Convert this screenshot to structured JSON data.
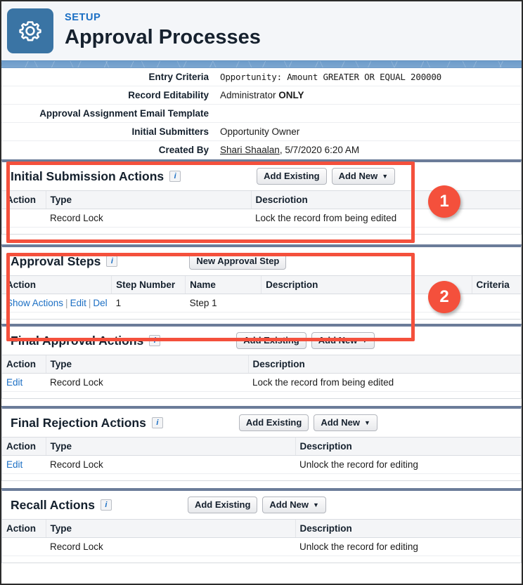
{
  "header": {
    "eyebrow": "SETUP",
    "title": "Approval Processes",
    "gear_icon": "gear-icon"
  },
  "detail_rows": [
    {
      "label": "Entry Criteria",
      "value": "Opportunity:  Amount  GREATER OR EQUAL 200000",
      "style": "mono"
    },
    {
      "label": "Record Editability",
      "value_prefix": "Administrator ",
      "value_bold": "ONLY"
    },
    {
      "label": "Approval Assignment Email Template",
      "value": ""
    },
    {
      "label": "Initial Submitters",
      "value": "Opportunity Owner"
    },
    {
      "label": "Created By",
      "link_text": "Shari Shaalan",
      "value_suffix": ", 5/7/2020 6:20 AM"
    }
  ],
  "panels": [
    {
      "title": "Initial Submission Actions",
      "info_icon": "info-icon",
      "buttons": [
        {
          "label": "Add Existing",
          "has_caret": false
        },
        {
          "label": "Add New",
          "has_caret": true
        }
      ],
      "columns": [
        "Action",
        "Type",
        "Descriotion"
      ],
      "rows": [
        {
          "action": "",
          "type": "Record Lock",
          "description": "Lock the record from being edited"
        }
      ]
    },
    {
      "title": "Approval Steps",
      "info_icon": "info-icon",
      "buttons": [
        {
          "label": "New Approval Step",
          "has_caret": false
        }
      ],
      "columns": [
        "Action",
        "Step Number",
        "Name",
        "Description",
        "Criteria"
      ],
      "rows": [
        {
          "links": [
            "Show Actions",
            "Edit",
            "Del"
          ],
          "step_number": "1",
          "name": "Step 1",
          "description": "",
          "criteria": ""
        }
      ]
    },
    {
      "title": "Final Approval Actions",
      "info_icon": "info-icon",
      "buttons": [
        {
          "label": "Add Existing",
          "has_caret": false
        },
        {
          "label": "Add New",
          "has_caret": true
        }
      ],
      "columns": [
        "Action",
        "Type",
        "Description"
      ],
      "rows": [
        {
          "action": "Edit",
          "type": "Record Lock",
          "description": "Lock the record from being edited"
        }
      ]
    },
    {
      "title": "Final Rejection Actions",
      "info_icon": "info-icon",
      "buttons": [
        {
          "label": "Add Existing",
          "has_caret": false
        },
        {
          "label": "Add New",
          "has_caret": true
        }
      ],
      "columns": [
        "Action",
        "Type",
        "Description"
      ],
      "rows": [
        {
          "action": "Edit",
          "type": "Record Lock",
          "description": "Unlock the record for editing"
        }
      ]
    },
    {
      "title": "Recall Actions",
      "info_icon": "info-icon",
      "buttons": [
        {
          "label": "Add Existing",
          "has_caret": false
        },
        {
          "label": "Add New",
          "has_caret": true
        }
      ],
      "columns": [
        "Action",
        "Type",
        "Description"
      ],
      "rows": [
        {
          "action": "",
          "type": "Record Lock",
          "description": "Unlock the record for editing"
        }
      ]
    }
  ],
  "annotations": [
    {
      "number": "1",
      "color": "#f4503c"
    },
    {
      "number": "2",
      "color": "#f4503c"
    }
  ]
}
